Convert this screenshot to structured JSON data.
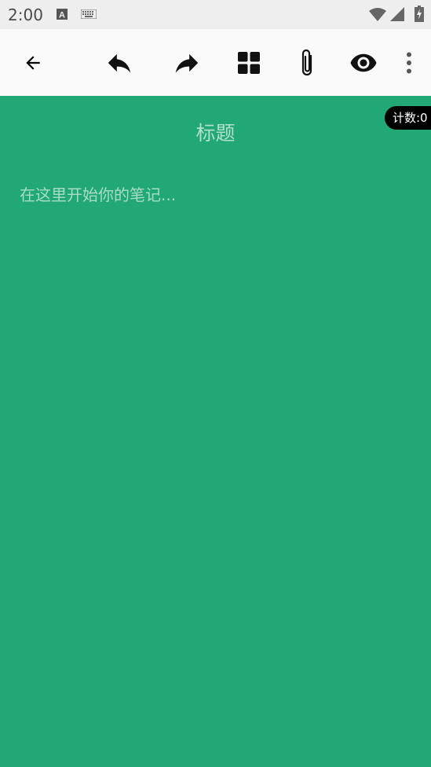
{
  "status_bar": {
    "time": "2:00",
    "icons": [
      "font-a-icon",
      "keyboard-icon",
      "wifi-icon",
      "signal-icon",
      "battery-charging-icon"
    ]
  },
  "toolbar": {
    "icons": [
      "back-arrow-icon",
      "undo-icon",
      "redo-icon",
      "grid-icon",
      "attachment-icon",
      "eye-icon",
      "more-vert-icon"
    ]
  },
  "editor": {
    "title_placeholder": "标题",
    "body_placeholder": "在这里开始你的笔记...",
    "counter_label": "计数:0"
  },
  "colors": {
    "background": "#22a776",
    "toolbar": "#fafafa",
    "status_bar": "#eeeeee"
  }
}
